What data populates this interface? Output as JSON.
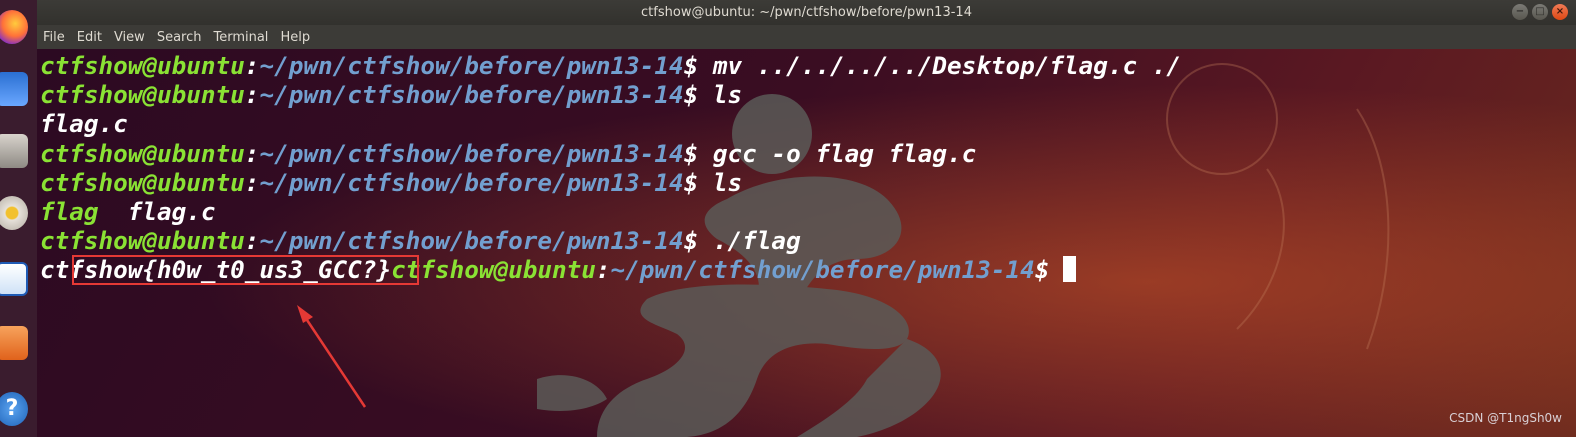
{
  "window": {
    "title": "ctfshow@ubuntu: ~/pwn/ctfshow/before/pwn13-14",
    "controls": [
      "−",
      "□",
      "×"
    ]
  },
  "menu": [
    "File",
    "Edit",
    "View",
    "Search",
    "Terminal",
    "Help"
  ],
  "dock": {
    "icons": [
      "firefox-icon",
      "mail-icon",
      "files-icon",
      "rhythmbox-icon",
      "writer-icon",
      "software-icon",
      "help-icon"
    ]
  },
  "terminal": {
    "user": "ctfshow@ubuntu",
    "colon": ":",
    "path": "~/pwn/ctfshow/before/pwn13-14",
    "prompt_symbol": "$",
    "lines": [
      {
        "kind": "prompt",
        "command": " mv ../../../../Desktop/flag.c ./"
      },
      {
        "kind": "prompt",
        "command": " ls"
      },
      {
        "kind": "output",
        "text": "flag.c"
      },
      {
        "kind": "prompt",
        "command": " gcc -o flag flag.c"
      },
      {
        "kind": "prompt",
        "command": " ls"
      },
      {
        "kind": "ls",
        "exe": "flag",
        "file": "flag.c"
      },
      {
        "kind": "prompt",
        "command": " ./flag"
      },
      {
        "kind": "flag",
        "flag": "ctfshow{h0w_t0_us3_GCC?}"
      }
    ]
  },
  "colors": {
    "user": "#8ae234",
    "path": "#729fcf",
    "annotation": "#e53935"
  },
  "watermark": "CSDN @T1ngSh0w"
}
